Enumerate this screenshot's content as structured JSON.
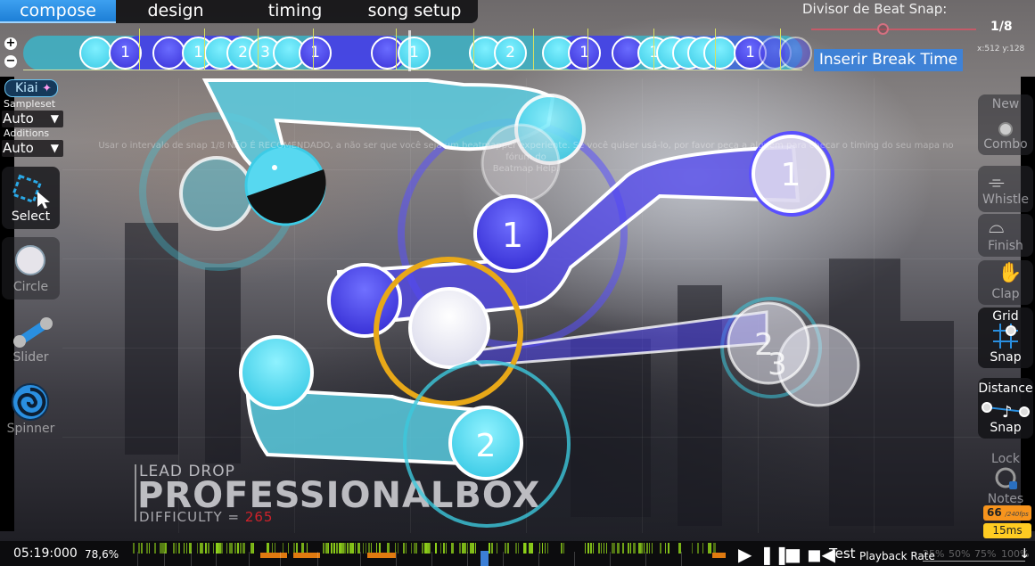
{
  "menu": {
    "tabs": [
      {
        "label": "compose",
        "active": true
      },
      {
        "label": "design",
        "active": false
      },
      {
        "label": "timing",
        "active": false
      },
      {
        "label": "song setup",
        "active": false
      }
    ]
  },
  "timeline": {
    "zoom_in_label": "+",
    "zoom_out_label": "−",
    "objects": [
      {
        "type": "circle",
        "color": "cyan",
        "number": ""
      },
      {
        "type": "circle",
        "color": "blue",
        "number": "1"
      },
      {
        "type": "circle",
        "color": "blue",
        "number": ""
      },
      {
        "type": "circle",
        "color": "cyan",
        "number": "1"
      },
      {
        "type": "circle",
        "color": "cyan",
        "number": ""
      },
      {
        "type": "circle",
        "color": "cyan",
        "number": "2"
      },
      {
        "type": "circle",
        "color": "cyan",
        "number": "3"
      },
      {
        "type": "circle",
        "color": "cyan",
        "number": ""
      },
      {
        "type": "circle",
        "color": "blue",
        "number": "1"
      },
      {
        "type": "circle",
        "color": "blue",
        "number": ""
      },
      {
        "type": "circle",
        "color": "cyan",
        "number": "1"
      },
      {
        "type": "circle",
        "color": "cyan",
        "number": ""
      },
      {
        "type": "circle",
        "color": "cyan",
        "number": "2"
      },
      {
        "type": "circle",
        "color": "cyan",
        "number": ""
      },
      {
        "type": "circle",
        "color": "blue",
        "number": "1"
      },
      {
        "type": "circle",
        "color": "blue",
        "number": ""
      },
      {
        "type": "circle",
        "color": "cyan",
        "number": "1"
      },
      {
        "type": "circle",
        "color": "cyan",
        "number": ""
      },
      {
        "type": "circle",
        "color": "cyan",
        "number": ""
      },
      {
        "type": "circle",
        "color": "cyan",
        "number": ""
      },
      {
        "type": "circle",
        "color": "cyan",
        "number": ""
      },
      {
        "type": "circle",
        "color": "blue",
        "number": "1"
      },
      {
        "type": "circle",
        "color": "blue",
        "number": ""
      },
      {
        "type": "circle",
        "color": "blue",
        "number": ""
      }
    ]
  },
  "beat_snap": {
    "label": "Divisor de Beat Snap:",
    "value": "1/8",
    "slider_position": 0.43
  },
  "cursor_coords": "x:512 y:128",
  "insert_break_label": "Inserir Break Time",
  "left_panel": {
    "kiai_label": "Kiai",
    "sampleset_label": "Sampleset",
    "sampleset_value": "Auto",
    "additions_label": "Additions",
    "additions_value": "Auto",
    "tools": [
      {
        "label": "Select",
        "icon": "select-icon",
        "active": true
      },
      {
        "label": "Circle",
        "icon": "circle-icon",
        "active": false
      },
      {
        "label": "Slider",
        "icon": "slider-icon",
        "active": false
      },
      {
        "label": "Spinner",
        "icon": "spinner-icon",
        "active": false
      }
    ]
  },
  "right_panel": {
    "new_combo": {
      "top": "New",
      "bottom": "Combo"
    },
    "whistle": "Whistle",
    "finish": "Finish",
    "clap": "Clap",
    "grid_snap": {
      "top": "Grid",
      "bottom": "Snap"
    },
    "distance_snap": {
      "top": "Distance",
      "bottom": "Snap"
    },
    "lock_notes": {
      "top": "Lock",
      "bottom": "Notes"
    },
    "fps": "66",
    "fps_limit": "/240fps",
    "latency": "15ms"
  },
  "playfield": {
    "warning_line1": "Usar o intervalo de snap 1/8 NÃO É RECOMENDADO, a não ser que você seja um beatmapper experiente. Se você quiser usá-lo, por favor peça a alguém para checar o timing do seu mapa no fórum do",
    "warning_line2": "Beatmap Help.",
    "combo_numbers": [
      "1",
      "1",
      "2",
      "2",
      "3"
    ]
  },
  "song_info": {
    "artist": "LEAD DROP",
    "title": "PROFESSIONALBOX",
    "difficulty_label": "DIFFICULTY = ",
    "difficulty_value": "265"
  },
  "bottom": {
    "time": "05:19:000",
    "progress": "78,6%",
    "test_label": "Test",
    "playback_rate_label": "Playback Rate",
    "playback_rates": [
      "25%",
      "50%",
      "75%",
      "100%"
    ],
    "playback_rate_selected": "100%"
  },
  "colors": {
    "accent_blue": "#3f82d6",
    "combo_cyan": "#3ccbe6",
    "combo_blue": "#3a32d8",
    "approach_gold": "#e8a818",
    "kiai_orange": "#e07a10",
    "waveform_green": "#8fd21a",
    "fps_orange": "#f7941d",
    "latency_yellow": "#ffcc22",
    "difficulty_red": "#d0222a"
  }
}
